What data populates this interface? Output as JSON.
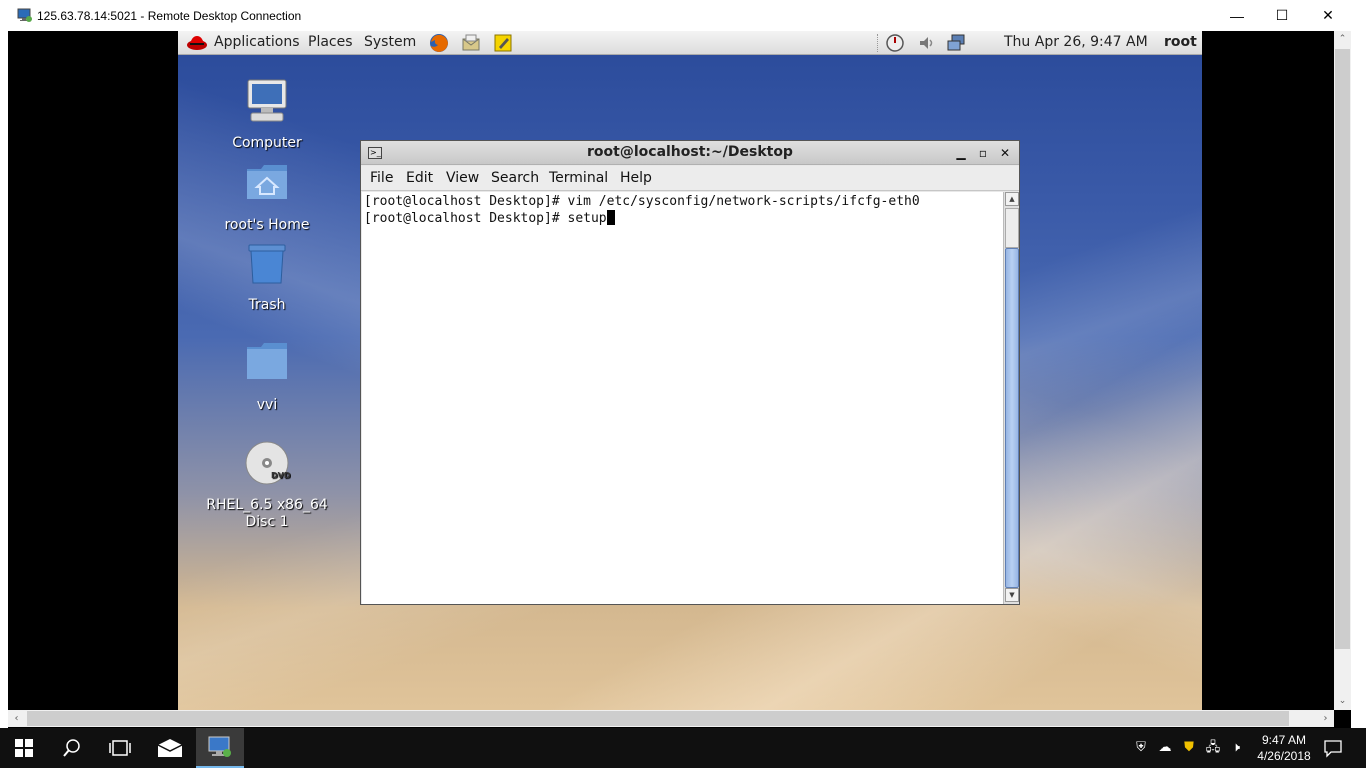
{
  "rdp": {
    "title": "125.63.78.14:5021 - Remote Desktop Connection",
    "minimize_icon": "minimize-icon",
    "maximize_icon": "maximize-icon",
    "close_icon": "close-icon",
    "min_glyph": "—",
    "max_glyph": "☐",
    "close_glyph": "✕"
  },
  "gnome_panel": {
    "menus": [
      "Applications",
      "Places",
      "System"
    ],
    "datetime": "Thu Apr 26,  9:47 AM",
    "user": "root"
  },
  "desktop_icons": [
    {
      "label": "Computer",
      "icon": "computer-icon"
    },
    {
      "label": "root's Home",
      "icon": "home-folder-icon"
    },
    {
      "label": "Trash",
      "icon": "trash-icon"
    },
    {
      "label": "vvi",
      "icon": "folder-icon"
    },
    {
      "label": "RHEL_6.5 x86_64 Disc 1",
      "icon": "dvd-icon"
    }
  ],
  "terminal": {
    "title": "root@localhost:~/Desktop",
    "menu": [
      "File",
      "Edit",
      "View",
      "Search",
      "Terminal",
      "Help"
    ],
    "lines": [
      "[root@localhost Desktop]# vim /etc/sysconfig/network-scripts/ifcfg-eth0",
      "[root@localhost Desktop]# setup"
    ]
  },
  "taskbar": {
    "time": "9:47 AM",
    "date": "4/26/2018"
  },
  "colors": {
    "taskbar_bg": "#101010",
    "accent": "#76b9ed",
    "desktop_top": "#2a4a9a",
    "desktop_bottom": "#e0c49a"
  }
}
